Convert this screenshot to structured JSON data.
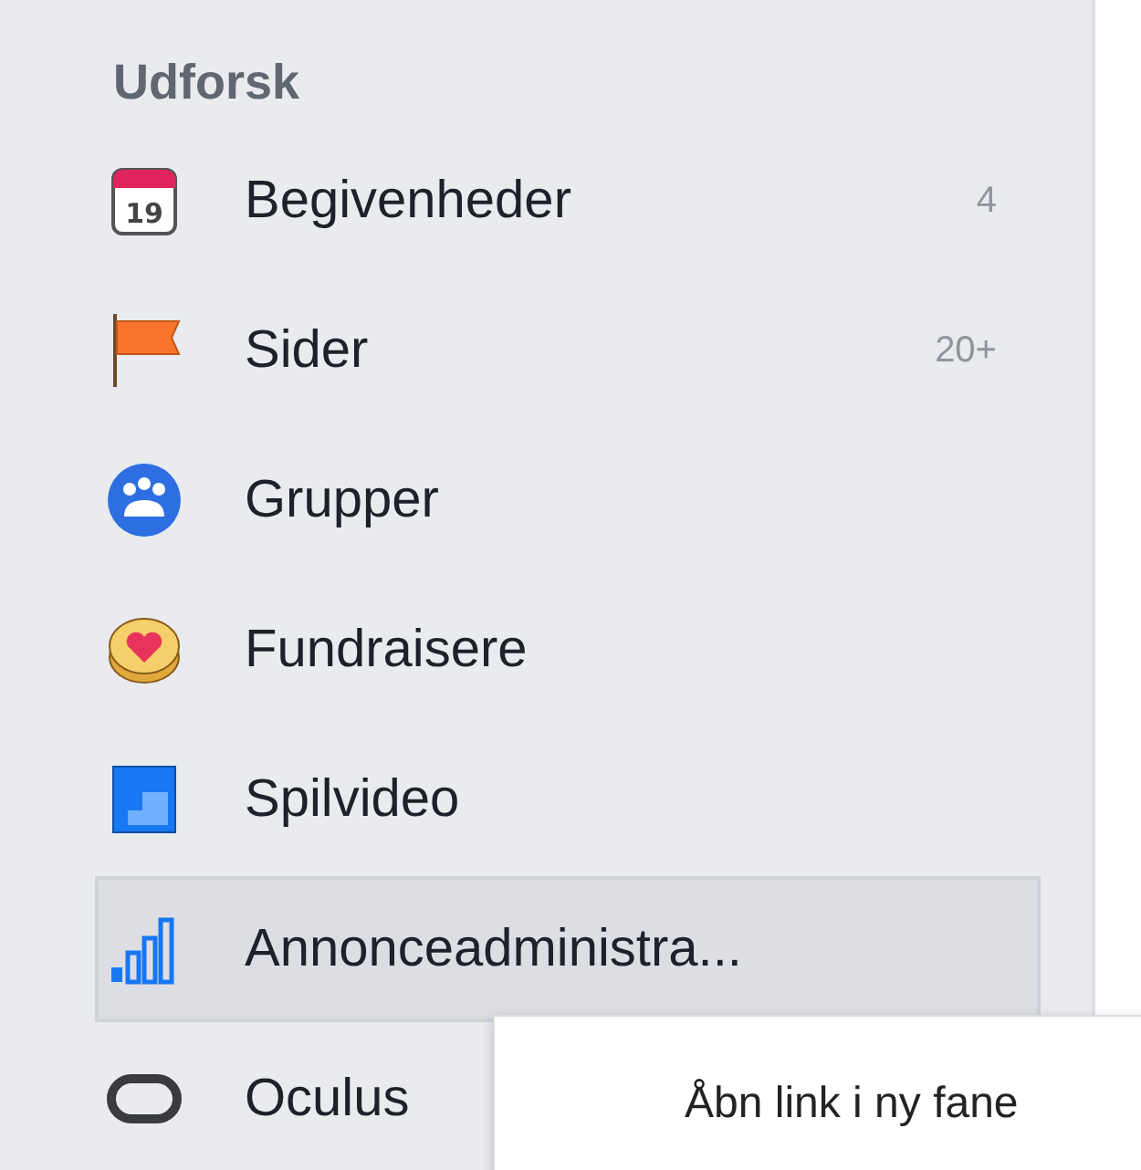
{
  "section_title": "Udforsk",
  "items": [
    {
      "label": "Begivenheder",
      "count": "4",
      "icon_text": "19",
      "highlighted": false
    },
    {
      "label": "Sider",
      "count": "20+",
      "highlighted": false
    },
    {
      "label": "Grupper",
      "highlighted": false
    },
    {
      "label": "Fundraisere",
      "highlighted": false
    },
    {
      "label": "Spilvideo",
      "highlighted": false
    },
    {
      "label": "Annonceadministra...",
      "highlighted": true
    },
    {
      "label": "Oculus",
      "highlighted": false
    }
  ],
  "context_menu": {
    "items": [
      "Åbn link i ny fane"
    ]
  }
}
